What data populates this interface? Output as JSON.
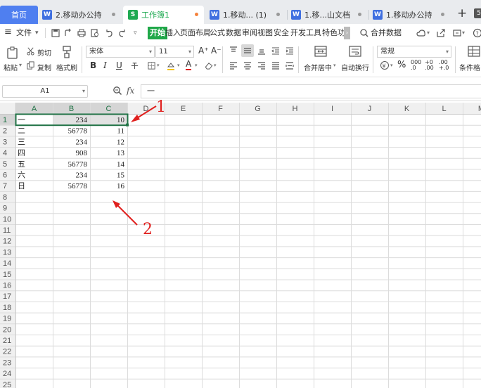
{
  "tabs": {
    "home": "首页",
    "items": [
      {
        "label": "2.移动办公持",
        "icon": "W",
        "color": "#3f6fe0"
      },
      {
        "label": "工作簿1",
        "icon": "S",
        "color": "#1faa52"
      },
      {
        "label": "1.移动... (1)",
        "icon": "W",
        "color": "#3f6fe0"
      },
      {
        "label": "1.移...山文档",
        "icon": "W",
        "color": "#3f6fe0"
      },
      {
        "label": "1.移动办公持",
        "icon": "W",
        "color": "#3f6fe0"
      }
    ],
    "plus": "+",
    "badge": "5"
  },
  "menu": {
    "file": "文件",
    "items": [
      "开始",
      "插入",
      "页面布局",
      "公式",
      "数据",
      "审阅",
      "视图",
      "安全",
      "开发工具",
      "特色功"
    ],
    "search": "合并数据"
  },
  "ribbon": {
    "paste": "粘贴",
    "cut": "剪切",
    "copy": "复制",
    "format_painter": "格式刷",
    "font_name": "宋体",
    "font_size": "11",
    "merge_center": "合并居中",
    "wrap_text": "自动换行",
    "number_format": "常规",
    "conditional_format": "条件格",
    "bold": "B",
    "italic": "I",
    "underline": "U",
    "font_color_letter": "A",
    "percent": "%"
  },
  "formula_bar": {
    "cell_ref": "A1",
    "fx": "fx",
    "content": "一"
  },
  "sheet": {
    "columns": [
      "A",
      "B",
      "C",
      "D",
      "E",
      "F",
      "G",
      "H",
      "I",
      "J",
      "K",
      "L",
      "M"
    ],
    "row_count": 25,
    "rows": [
      [
        "一",
        "234",
        "10"
      ],
      [
        "二",
        "56778",
        "11"
      ],
      [
        "三",
        "234",
        "12"
      ],
      [
        "四",
        "908",
        "13"
      ],
      [
        "五",
        "56778",
        "14"
      ],
      [
        "六",
        "234",
        "15"
      ],
      [
        "日",
        "56778",
        "16"
      ]
    ],
    "accent": "#217346",
    "header_bg": "#f0f0f0",
    "selected_header_bg": "#d5d5d5"
  },
  "annotations": {
    "one": "1",
    "two": "2",
    "color": "#e0201e"
  }
}
